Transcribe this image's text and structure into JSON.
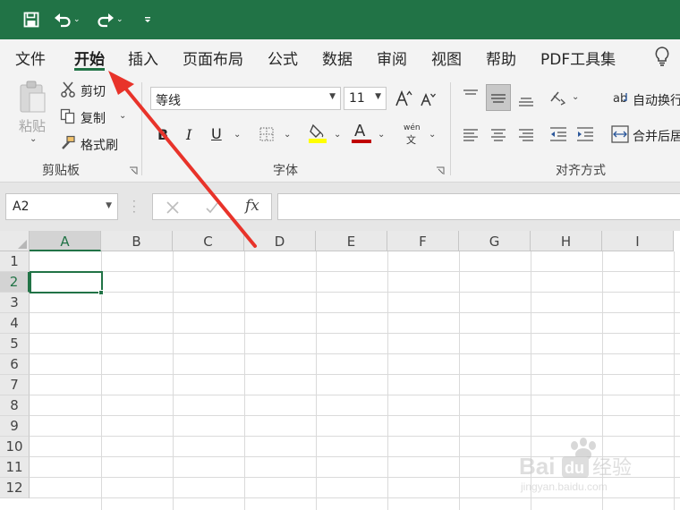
{
  "titlebar": {
    "save_icon": "save-icon",
    "undo_icon": "undo-icon",
    "redo_icon": "redo-icon",
    "customize_icon": "customize-quick-access-icon"
  },
  "tabs": [
    {
      "label": "文件"
    },
    {
      "label": "开始",
      "active": true
    },
    {
      "label": "插入"
    },
    {
      "label": "页面布局"
    },
    {
      "label": "公式"
    },
    {
      "label": "数据"
    },
    {
      "label": "审阅"
    },
    {
      "label": "视图"
    },
    {
      "label": "帮助"
    },
    {
      "label": "PDF工具集"
    }
  ],
  "tell_me_icon": "lightbulb-icon",
  "clipboard": {
    "paste": "粘贴",
    "cut": "剪切",
    "copy": "复制",
    "format_painter": "格式刷",
    "group": "剪贴板"
  },
  "font": {
    "name": "等线",
    "size": "11",
    "bold": "B",
    "italic": "I",
    "underline": "U",
    "font_color_letter": "A",
    "fill_color": "#ffff00",
    "font_color": "#c00000",
    "phonetic_top": "wén",
    "phonetic_bottom": "文",
    "group": "字体"
  },
  "alignment": {
    "wrap_text": "自动换行",
    "merge_center": "合并后居",
    "group": "对齐方式"
  },
  "formula_bar": {
    "name_box": "A2",
    "fx": "fx",
    "value": ""
  },
  "grid": {
    "columns": [
      "A",
      "B",
      "C",
      "D",
      "E",
      "F",
      "G",
      "H",
      "I"
    ],
    "rows": [
      "1",
      "2",
      "3",
      "4",
      "5",
      "6",
      "7",
      "8",
      "9",
      "10",
      "11",
      "12"
    ],
    "selected_cell": "A2"
  },
  "annotation": {
    "color": "#e8332a"
  },
  "watermark": {
    "line1": "Baidu经验",
    "line2": "jingyan.baidu.com"
  }
}
